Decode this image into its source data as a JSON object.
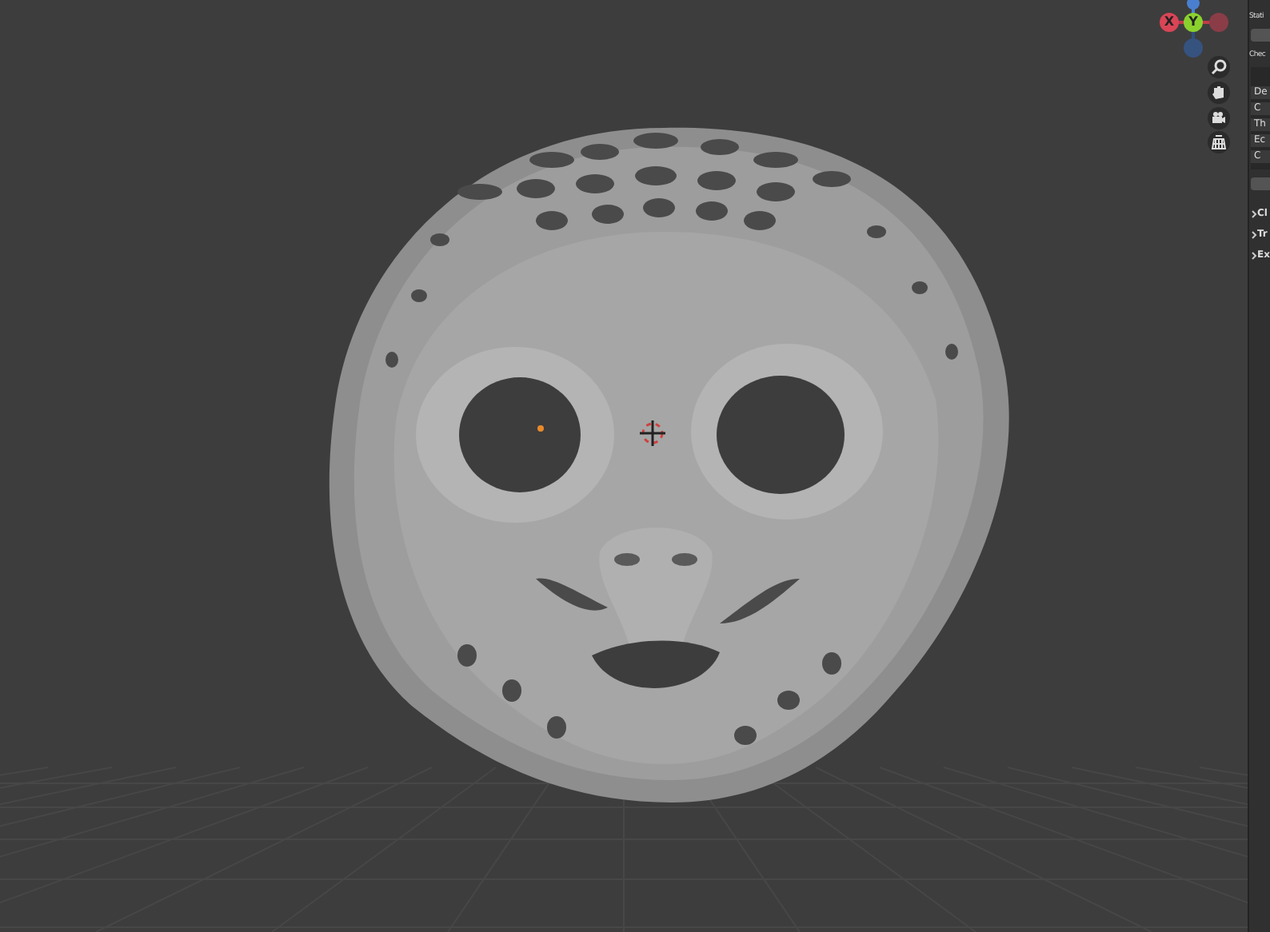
{
  "viewport": {
    "gizmo": {
      "x_label": "X",
      "y_label": "Y"
    }
  },
  "panel": {
    "title": "Stati",
    "check_label": "Chec",
    "rows": [
      "De",
      "C",
      "Th",
      "Ec",
      "C"
    ],
    "sections": [
      {
        "label": "Cl",
        "expanded": false
      },
      {
        "label": "Tr",
        "expanded": false
      },
      {
        "label": "Ex",
        "expanded": false
      }
    ]
  }
}
